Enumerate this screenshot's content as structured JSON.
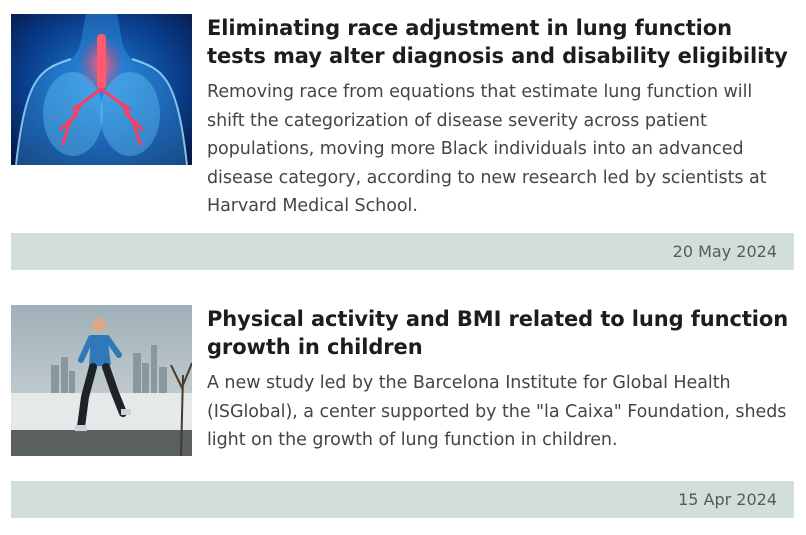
{
  "articles": [
    {
      "title": "Eliminating race adjustment in lung function tests may alter diagnosis and disability eligibility",
      "summary": "Removing race from equations that estimate lung function will shift the categorization of disease severity across patient populations, moving more Black individuals into an advanced disease category, according to new research led by scientists at Harvard Medical School.",
      "date": "20 May 2024",
      "image_icon": "lungs-anatomy-illustration"
    },
    {
      "title": "Physical activity and BMI related to lung function growth in children",
      "summary": "A new study led by the Barcelona Institute for Global Health (ISGlobal), a center supported by the \"la Caixa\" Foundation, sheds light on the growth of lung function in children.",
      "date": "15 Apr 2024",
      "image_icon": "man-jogging-photo"
    }
  ],
  "colors": {
    "date_bar": "#d1dedb",
    "title": "#1d1d1d",
    "summary": "#454545"
  }
}
